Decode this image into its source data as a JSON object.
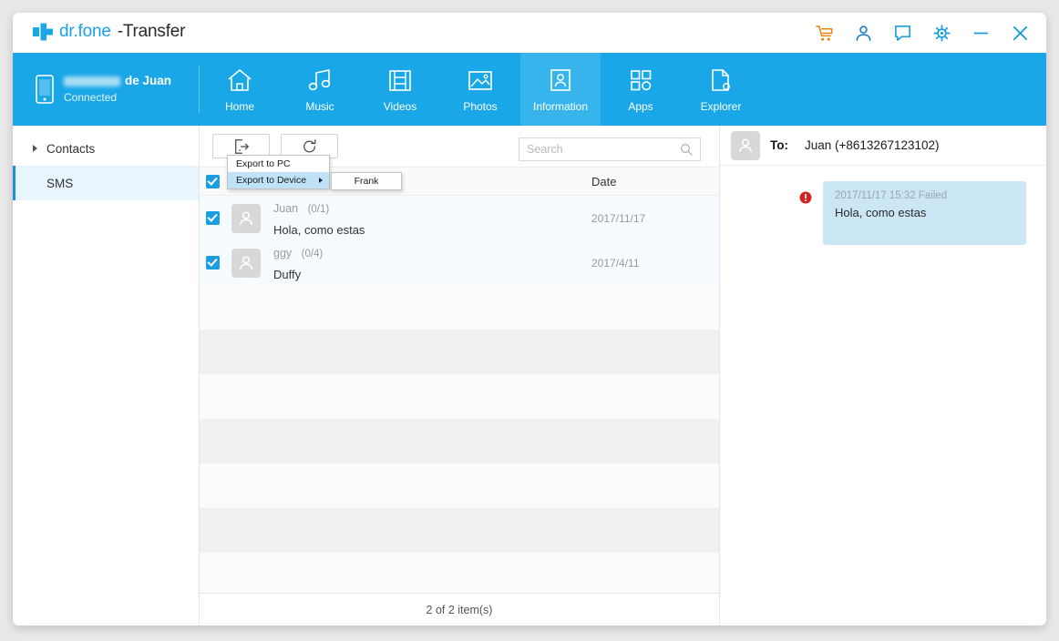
{
  "titlebar": {
    "brand": "dr.fone",
    "product": " -Transfer",
    "icons": [
      {
        "name": "cart-icon"
      },
      {
        "name": "account-icon"
      },
      {
        "name": "feedback-icon"
      },
      {
        "name": "settings-icon"
      },
      {
        "name": "minimize-icon"
      },
      {
        "name": "close-icon"
      }
    ]
  },
  "device": {
    "name_suffix": "de Juan",
    "status": "Connected"
  },
  "nav": {
    "tabs": [
      {
        "label": "Home",
        "icon": "home-icon",
        "active": false
      },
      {
        "label": "Music",
        "icon": "music-icon",
        "active": false
      },
      {
        "label": "Videos",
        "icon": "videos-icon",
        "active": false
      },
      {
        "label": "Photos",
        "icon": "photos-icon",
        "active": false
      },
      {
        "label": "Information",
        "icon": "information-icon",
        "active": true
      },
      {
        "label": "Apps",
        "icon": "apps-icon",
        "active": false
      },
      {
        "label": "Explorer",
        "icon": "explorer-icon",
        "active": false
      }
    ]
  },
  "sidebar": {
    "items": [
      {
        "label": "Contacts",
        "active": false,
        "expandable": true
      },
      {
        "label": "SMS",
        "active": true,
        "expandable": false
      }
    ]
  },
  "toolbar": {
    "export_icon": "export-icon",
    "refresh_icon": "refresh-icon"
  },
  "search": {
    "value": "",
    "placeholder": "Search",
    "icon": "search-icon"
  },
  "context_menu": {
    "items": [
      {
        "label": "Export to PC",
        "highlighted": false,
        "has_submenu": false
      },
      {
        "label": "Export to Device",
        "highlighted": true,
        "has_submenu": true
      }
    ],
    "submenu": [
      {
        "label": "Frank"
      }
    ]
  },
  "list": {
    "columns": {
      "date": "Date"
    },
    "rows": [
      {
        "name": "Juan",
        "count": "(0/1)",
        "message": "Hola, como estas",
        "date": "2017/11/17",
        "checked": true
      },
      {
        "name": "ggy",
        "count": "(0/4)",
        "message": "Duffy",
        "date": "2017/4/11",
        "checked": true
      }
    ],
    "status": "2 of 2 item(s)"
  },
  "conversation": {
    "to_label": "To:",
    "to_value": "Juan (+8613267123102)",
    "messages": [
      {
        "time": "2017/11/17 15:32 Failed",
        "text": "Hola, como estas",
        "failed": true
      }
    ]
  },
  "colors": {
    "brand_blue": "#19a7e8",
    "accent": "#1b9ee0",
    "active_tab": "#38b4ec",
    "bubble": "#cbe6f5",
    "error": "#d32222",
    "cart_orange": "#e8820c"
  }
}
